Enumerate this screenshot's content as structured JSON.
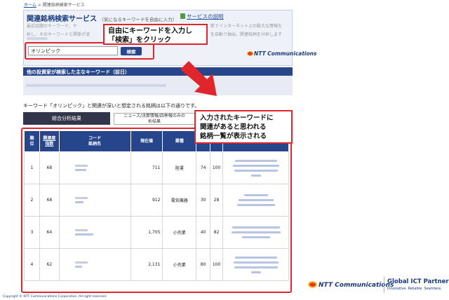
{
  "breadcrumb": {
    "home": "ホーム",
    "separator": ">",
    "current": "関連銘柄検索サービス"
  },
  "service": {
    "title": "関連銘柄検索サービス",
    "subtitle": "（気になるキーワードを自由に入力）",
    "help_link": "サービスの説明",
    "desc_fragments": [
      "最近話題のキーワード、や",
      "析し、そのキーワードと関係が深",
      "新でインターネット上の膨大な情報を",
      "を自動で抽出。関連銘柄を分析します"
    ]
  },
  "search": {
    "value": "オリンピック",
    "button_label": "検索"
  },
  "ntt_logo_small": "NTT Communications",
  "callout_search": {
    "line1": "自由にキーワードを入力し",
    "line2": "「検索」をクリック"
  },
  "keyword_section": {
    "heading": "他の投資家が検索した主なキーワード（前日）"
  },
  "result_summary": "キーワード「オリンピック」と関連が深いと想定される銘柄は以下の通りです。",
  "tabs": {
    "active": "総合分析結果",
    "other_line1": "ニュース/決算情報/四季報のみの",
    "other_line2": "析結果"
  },
  "callout_table": {
    "line1": "入力されたキーワードに",
    "line2": "関連があると思われる",
    "line3": "銘柄一覧が表示される"
  },
  "table": {
    "headers": {
      "rank_1": "順",
      "rank_2": "位",
      "score_1": "関連度",
      "score_2": "指数",
      "code_1": "コード",
      "code_2": "銘柄名",
      "price": "現在値",
      "industry": "業種",
      "p": "P",
      "n": "N"
    },
    "rows": [
      {
        "rank": "1",
        "score": "68",
        "price": "711",
        "industry": "陸運",
        "p": "74",
        "n": "100"
      },
      {
        "rank": "2",
        "score": "68",
        "price": "912",
        "industry": "電気機器",
        "p": "30",
        "n": "28"
      },
      {
        "rank": "3",
        "score": "64",
        "price": "1,705",
        "industry": "小売業",
        "p": "40",
        "n": "82"
      },
      {
        "rank": "4",
        "score": "62",
        "price": "2,131",
        "industry": "小売業",
        "p": "80",
        "n": "100"
      }
    ]
  },
  "footer": {
    "copyright": "Copyright © NTT Communications Corporation. All right reserved."
  },
  "brand": {
    "ntt": "NTT Communications",
    "global": "Global ICT Partner",
    "tagline": "Innovative. Reliable. Seamless."
  },
  "colors": {
    "navy": "#27458a",
    "callout_red": "#e0252b",
    "tab_dark": "#33364a"
  }
}
